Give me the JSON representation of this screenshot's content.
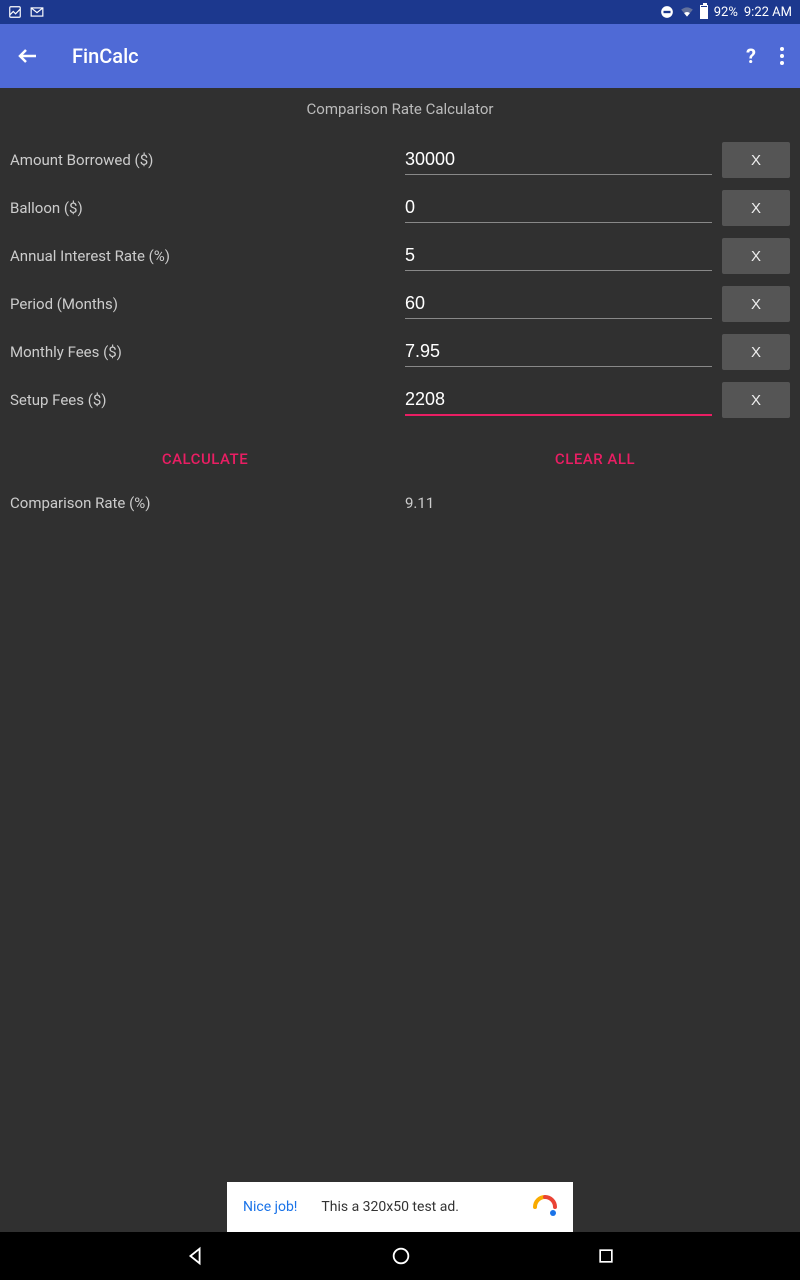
{
  "status": {
    "battery": "92%",
    "time": "9:22 AM"
  },
  "appbar": {
    "title": "FinCalc"
  },
  "page": {
    "title": "Comparison Rate Calculator"
  },
  "fields": [
    {
      "label": "Amount Borrowed ($)",
      "value": "30000",
      "clear": "X",
      "active": false
    },
    {
      "label": "Balloon ($)",
      "value": "0",
      "clear": "X",
      "active": false
    },
    {
      "label": "Annual Interest Rate (%)",
      "value": "5",
      "clear": "X",
      "active": false
    },
    {
      "label": "Period (Months)",
      "value": "60",
      "clear": "X",
      "active": false
    },
    {
      "label": "Monthly Fees ($)",
      "value": "7.95",
      "clear": "X",
      "active": false
    },
    {
      "label": "Setup Fees ($)",
      "value": "2208",
      "clear": "X",
      "active": true
    }
  ],
  "actions": {
    "calculate": "CALCULATE",
    "clear_all": "CLEAR ALL"
  },
  "result": {
    "label": "Comparison Rate (%)",
    "value": "9.11"
  },
  "ad": {
    "left": "Nice job!",
    "mid": "This a 320x50 test ad."
  }
}
